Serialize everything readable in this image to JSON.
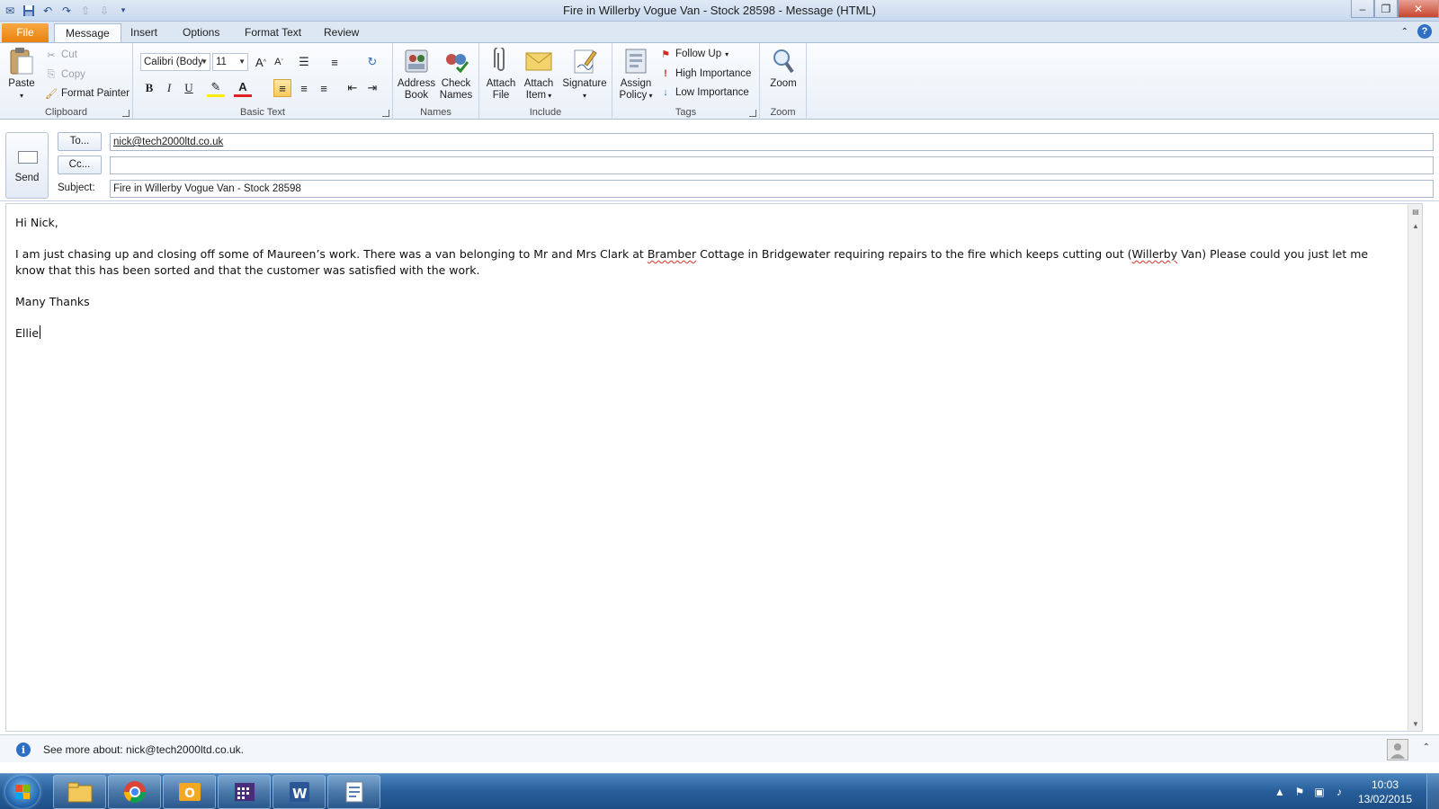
{
  "window": {
    "title": "Fire in Willerby Vogue Van - Stock 28598  -  Message (HTML)",
    "controls": [
      "minimize",
      "restore",
      "close"
    ]
  },
  "quick_access": [
    "save-icon",
    "undo-icon",
    "redo-icon",
    "up-icon",
    "down-icon",
    "customize-icon"
  ],
  "ribbon": {
    "tabs": [
      "File",
      "Message",
      "Insert",
      "Options",
      "Format Text",
      "Review"
    ],
    "active_tab": "Message",
    "clipboard": {
      "label": "Clipboard",
      "paste": "Paste",
      "cut": "Cut",
      "copy": "Copy",
      "format_painter": "Format Painter"
    },
    "basic_text": {
      "label": "Basic Text",
      "font": "Calibri (Bodу",
      "size": "11",
      "bold": "B",
      "italic": "I",
      "underline": "U"
    },
    "names": {
      "label": "Names",
      "address_book": [
        "Address",
        "Book"
      ],
      "check_names": [
        "Check",
        "Names"
      ]
    },
    "include": {
      "label": "Include",
      "attach_file": [
        "Attach",
        "File"
      ],
      "attach_item": [
        "Attach",
        "Item"
      ],
      "signature": "Signature"
    },
    "tags": {
      "label": "Tags",
      "assign_policy": [
        "Assign",
        "Policy"
      ],
      "follow_up": "Follow Up",
      "high_importance": "High Importance",
      "low_importance": "Low Importance"
    },
    "zoom": {
      "label": "Zoom",
      "zoom": "Zoom"
    }
  },
  "compose": {
    "send": "Send",
    "to_label": "To...",
    "to_value": "nick@tech2000ltd.co.uk",
    "cc_label": "Cc...",
    "cc_value": "",
    "subject_label": "Subject:",
    "subject_value": "Fire in Willerby Vogue Van - Stock 28598"
  },
  "message": {
    "greeting": "Hi Nick,",
    "para_1": "I am just chasing up and closing off some of Maureen’s work. There was a van belonging to Mr and Mrs Clark at ",
    "para_bramber": "Bramber",
    "para_2": " Cottage in Bridgewater requiring repairs to the fire which keeps cutting out (",
    "para_willerby": "Willerby",
    "para_3": " Van) Please could you just let me know that this has been sorted and that the customer was satisfied with the work.",
    "closing": "Many Thanks",
    "signature": "Ellie"
  },
  "people_pane": {
    "text": "See more about: nick@tech2000ltd.co.uk."
  },
  "taskbar": {
    "apps": [
      "windows-explorer-icon",
      "chrome-icon",
      "outlook-icon",
      "calendar-app-icon",
      "word-icon",
      "document-icon"
    ],
    "time": "10:03",
    "date": "13/02/2015"
  }
}
